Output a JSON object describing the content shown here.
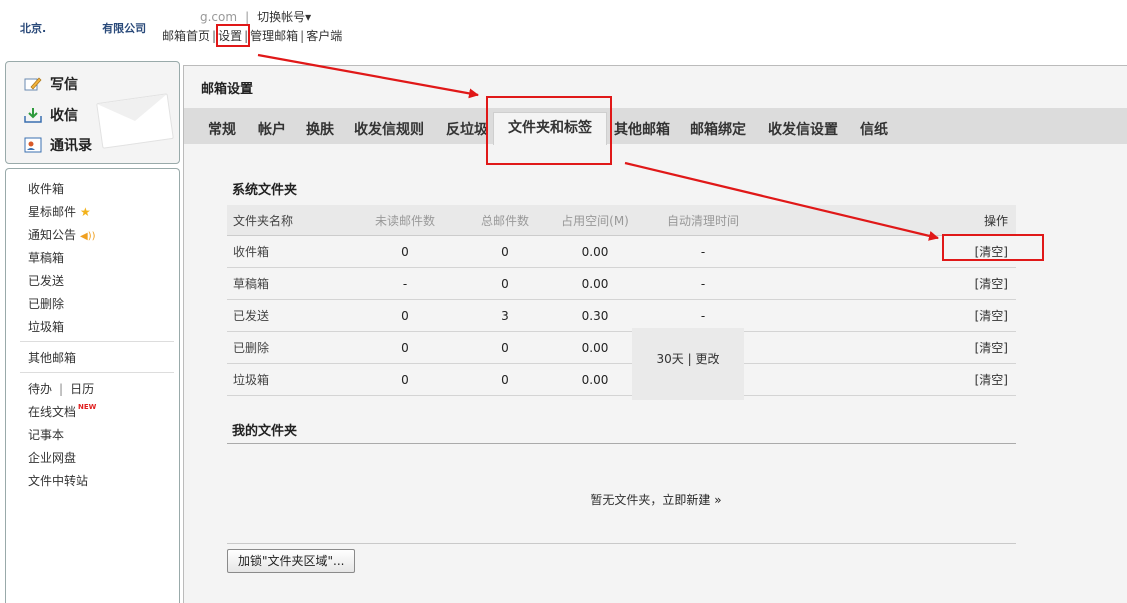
{
  "header": {
    "company_part1": "北京.",
    "company_part2": "有限公司",
    "account_partial": "g.com",
    "switch_account": "切换帐号▾",
    "nav": [
      "邮箱首页",
      "设置",
      "管理邮箱",
      "客户端"
    ]
  },
  "quick_actions": [
    {
      "label": "写信",
      "icon": "compose-icon"
    },
    {
      "label": "收信",
      "icon": "inbox-download-icon"
    },
    {
      "label": "通讯录",
      "icon": "contacts-icon"
    }
  ],
  "sidebar": {
    "system_folders": [
      "收件箱",
      "星标邮件",
      "通知公告",
      "草稿箱",
      "已发送",
      "已删除",
      "垃圾箱"
    ],
    "other_mail": "其他邮箱",
    "todo": "待办",
    "calendar": "日历",
    "online_docs": "在线文档",
    "new_badge": "NEW",
    "notepad": "记事本",
    "netdisk": "企业网盘",
    "transfer": "文件中转站"
  },
  "main": {
    "title": "邮箱设置",
    "tabs": [
      "常规",
      "帐户",
      "换肤",
      "收发信规则",
      "反垃圾",
      "文件夹和标签",
      "其他邮箱",
      "邮箱绑定",
      "收发信设置",
      "信纸"
    ],
    "active_tab": "文件夹和标签",
    "system_section_title": "系统文件夹",
    "columns": [
      "文件夹名称",
      "未读邮件数",
      "总邮件数",
      "占用空间(M)",
      "自动清理时间",
      "操作"
    ],
    "rows": [
      {
        "name": "收件箱",
        "unread": "0",
        "total": "0",
        "space": "0.00",
        "cleanup": "-",
        "action": "[清空]"
      },
      {
        "name": "草稿箱",
        "unread": "-",
        "total": "0",
        "space": "0.00",
        "cleanup": "-",
        "action": "[清空]"
      },
      {
        "name": "已发送",
        "unread": "0",
        "total": "3",
        "space": "0.30",
        "cleanup": "-",
        "action": "[清空]"
      },
      {
        "name": "已删除",
        "unread": "0",
        "total": "0",
        "space": "0.00",
        "cleanup": "",
        "action": "[清空]"
      },
      {
        "name": "垃圾箱",
        "unread": "0",
        "total": "0",
        "space": "0.00",
        "cleanup": "",
        "action": "[清空]"
      }
    ],
    "purge_days": "30天",
    "purge_change": "更改",
    "my_section_title": "我的文件夹",
    "empty_text": "暂无文件夹，",
    "create_now": "立即新建 »",
    "lock_button": "加锁\"文件夹区域\"..."
  },
  "annotation_color": "#e01818"
}
